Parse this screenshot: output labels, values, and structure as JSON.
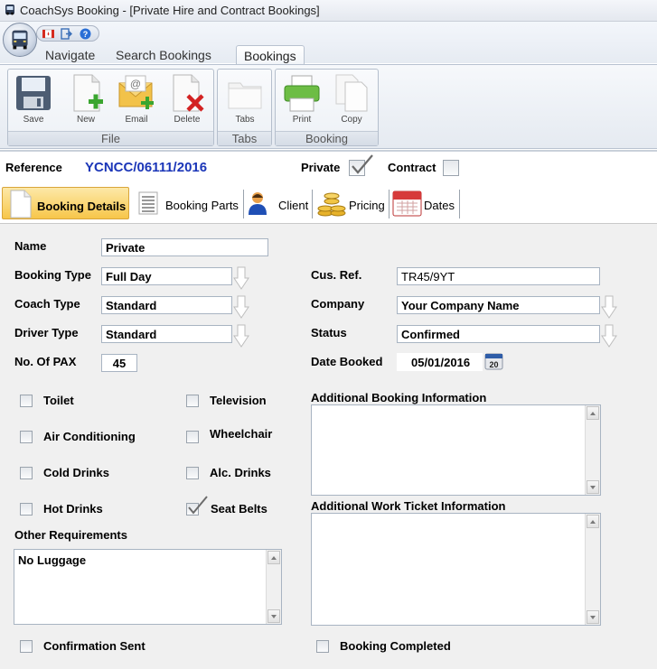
{
  "window": {
    "title": "CoachSys Booking - [Private Hire and Contract Bookings]"
  },
  "ribbon": {
    "tabs": [
      {
        "label": "Navigate",
        "active": false
      },
      {
        "label": "Search Bookings",
        "active": false
      },
      {
        "label": "Bookings",
        "active": true
      }
    ],
    "groups": {
      "file": {
        "label": "File",
        "buttons": {
          "save": "Save",
          "new": "New",
          "email": "Email",
          "delete": "Delete"
        }
      },
      "tabs": {
        "label": "Tabs",
        "buttons": {
          "tabs": "Tabs"
        }
      },
      "booking": {
        "label": "Booking",
        "buttons": {
          "print": "Print",
          "copy": "Copy"
        }
      }
    }
  },
  "header": {
    "reference_label": "Reference",
    "reference_value": "YCNCC/06111/2016",
    "private_label": "Private",
    "private_checked": true,
    "contract_label": "Contract",
    "contract_checked": false
  },
  "subtabs": {
    "booking_details": "Booking Details",
    "booking_parts": "Booking Parts",
    "client": "Client",
    "pricing": "Pricing",
    "dates": "Dates"
  },
  "form": {
    "name": {
      "label": "Name",
      "value": "Private"
    },
    "booking_type": {
      "label": "Booking Type",
      "value": "Full Day"
    },
    "coach_type": {
      "label": "Coach Type",
      "value": "Standard"
    },
    "driver_type": {
      "label": "Driver Type",
      "value": "Standard"
    },
    "pax": {
      "label": "No. Of PAX",
      "value": "45"
    },
    "cus_ref": {
      "label": "Cus. Ref.",
      "value": "TR45/9YT"
    },
    "company": {
      "label": "Company",
      "value": "Your Company Name"
    },
    "status": {
      "label": "Status",
      "value": "Confirmed"
    },
    "date_booked": {
      "label": "Date Booked",
      "value": "05/01/2016"
    },
    "amenities": {
      "toilet": {
        "label": "Toilet",
        "checked": false
      },
      "television": {
        "label": "Television",
        "checked": false
      },
      "air_conditioning": {
        "label": "Air Conditioning",
        "checked": false
      },
      "wheelchair": {
        "label": "Wheelchair",
        "checked": false
      },
      "cold_drinks": {
        "label": "Cold Drinks",
        "checked": false
      },
      "alc_drinks": {
        "label": "Alc. Drinks",
        "checked": false
      },
      "hot_drinks": {
        "label": "Hot Drinks",
        "checked": false
      },
      "seat_belts": {
        "label": "Seat Belts",
        "checked": true
      }
    },
    "other_requirements": {
      "label": "Other Requirements",
      "value": "No Luggage"
    },
    "additional_booking_info": {
      "label": "Additional Booking Information",
      "value": ""
    },
    "additional_work_ticket_info": {
      "label": "Additional Work Ticket Information",
      "value": ""
    },
    "confirmation_sent": {
      "label": "Confirmation Sent",
      "checked": false
    },
    "booking_completed": {
      "label": "Booking Completed",
      "checked": false
    }
  },
  "calendar_icon_text": "20"
}
